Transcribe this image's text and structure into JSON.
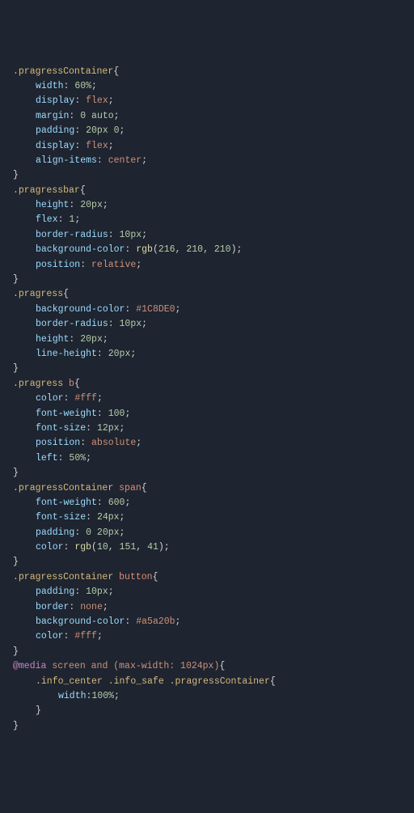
{
  "code": {
    "rules": [
      {
        "selector": ".pragressContainer",
        "declarations": [
          {
            "prop": "width",
            "value": "60%"
          },
          {
            "prop": "display",
            "value": "flex",
            "kw": true
          },
          {
            "prop": "margin",
            "value": "0 auto"
          },
          {
            "prop": "padding",
            "value": "20px 0"
          },
          {
            "prop": "display",
            "value": "flex",
            "kw": true
          },
          {
            "prop": "align-items",
            "value": "center",
            "kw": true
          }
        ]
      },
      {
        "selector": ".pragressbar",
        "declarations": [
          {
            "prop": "height",
            "value": "20px"
          },
          {
            "prop": "flex",
            "value": "1"
          },
          {
            "prop": "border-radius",
            "value": "10px"
          },
          {
            "prop": "background-color",
            "value": "rgb(216, 210, 210)",
            "func": true
          },
          {
            "prop": "position",
            "value": "relative",
            "kw": true
          }
        ]
      },
      {
        "selector": ".pragress",
        "declarations": [
          {
            "prop": "background-color",
            "value": "#1C8DE0",
            "hex": true
          },
          {
            "prop": "border-radius",
            "value": "10px"
          },
          {
            "prop": "height",
            "value": "20px"
          },
          {
            "prop": "line-height",
            "value": "20px"
          }
        ]
      },
      {
        "selector": ".pragress b",
        "selectorTag": "b",
        "declarations": [
          {
            "prop": "color",
            "value": "#fff",
            "hex": true
          },
          {
            "prop": "font-weight",
            "value": "100"
          },
          {
            "prop": "font-size",
            "value": "12px"
          },
          {
            "prop": "position",
            "value": "absolute",
            "kw": true
          },
          {
            "prop": "left",
            "value": "50%"
          }
        ]
      },
      {
        "selector": ".pragressContainer span",
        "selectorTag": "span",
        "declarations": [
          {
            "prop": "font-weight",
            "value": "600"
          },
          {
            "prop": "font-size",
            "value": "24px"
          },
          {
            "prop": "padding",
            "value": "0 20px"
          },
          {
            "prop": "color",
            "value": "rgb(10, 151, 41)",
            "func": true
          }
        ]
      },
      {
        "selector": ".pragressContainer button",
        "selectorTag": "button",
        "declarations": [
          {
            "prop": "padding",
            "value": "10px"
          },
          {
            "prop": "border",
            "value": "none",
            "kw": true
          },
          {
            "prop": "background-color",
            "value": "#a5a20b",
            "hex": true
          },
          {
            "prop": "color",
            "value": "#fff",
            "hex": true
          }
        ]
      }
    ],
    "media": {
      "at": "@media",
      "query": "screen and (max-width: 1024px)",
      "innerSelector": ".info_center .info_safe .pragressContainer",
      "decl": {
        "prop": "width",
        "value": "100%"
      }
    }
  }
}
